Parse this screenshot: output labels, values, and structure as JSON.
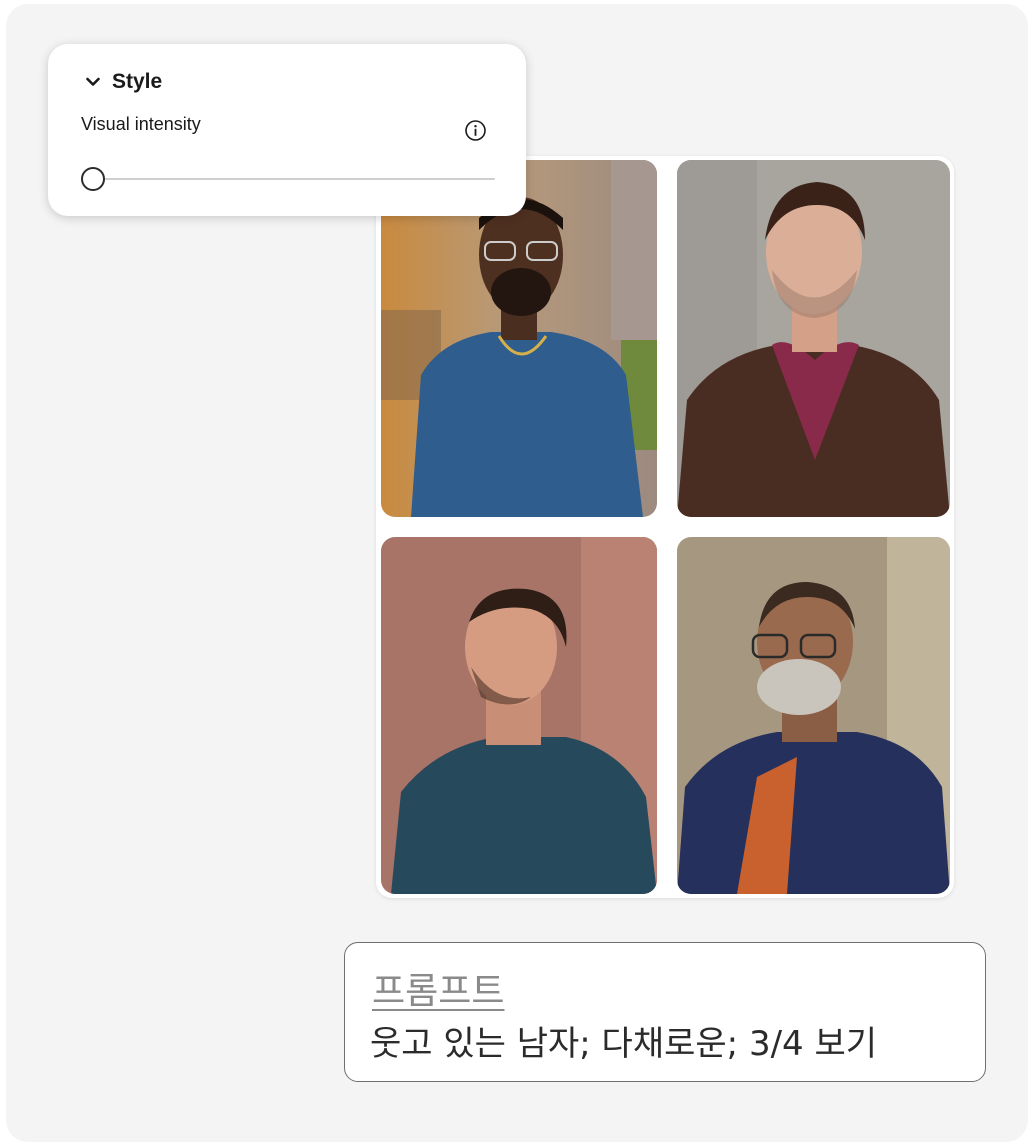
{
  "style_panel": {
    "title": "Style",
    "chevron_icon": "chevron-down-icon",
    "slider_label": "Visual intensity",
    "info_icon": "info-icon",
    "slider_value": 0
  },
  "images": [
    {
      "name": "portrait-man-blue-shirt-glasses"
    },
    {
      "name": "portrait-man-brown-sweater"
    },
    {
      "name": "portrait-man-profile-smiling"
    },
    {
      "name": "portrait-man-gray-beard-glasses"
    }
  ],
  "prompt": {
    "heading": "프롬프트",
    "text": "웃고 있는 남자; 다채로운; 3/4 보기"
  },
  "colors": {
    "background": "#f4f4f4",
    "panel": "#ffffff",
    "prompt_border": "#6f6f6f"
  }
}
